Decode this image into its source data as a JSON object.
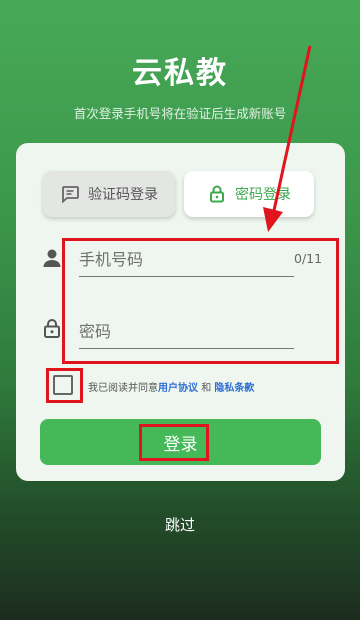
{
  "app": {
    "title": "云私教",
    "subtitle": "首次登录手机号将在验证后生成新账号"
  },
  "tabs": {
    "sms_label": "验证码登录",
    "password_label": "密码登录",
    "active": "password"
  },
  "form": {
    "phone_placeholder": "手机号码",
    "phone_counter": "0/11",
    "password_placeholder": "密码"
  },
  "agreement": {
    "prefix": "我已阅读并同意",
    "user_agreement": "用户协议",
    "conjunction": "和",
    "privacy_terms": "隐私条款",
    "checked": false
  },
  "buttons": {
    "login_label": "登录",
    "skip_label": "跳过"
  },
  "icons": {
    "sms_tab": "message-icon",
    "password_tab": "lock-icon",
    "phone_field": "person-icon",
    "password_field": "lock-icon"
  },
  "colors": {
    "accent": "#45b857",
    "link": "#2f6fd6",
    "annotation": "#e0141d"
  }
}
